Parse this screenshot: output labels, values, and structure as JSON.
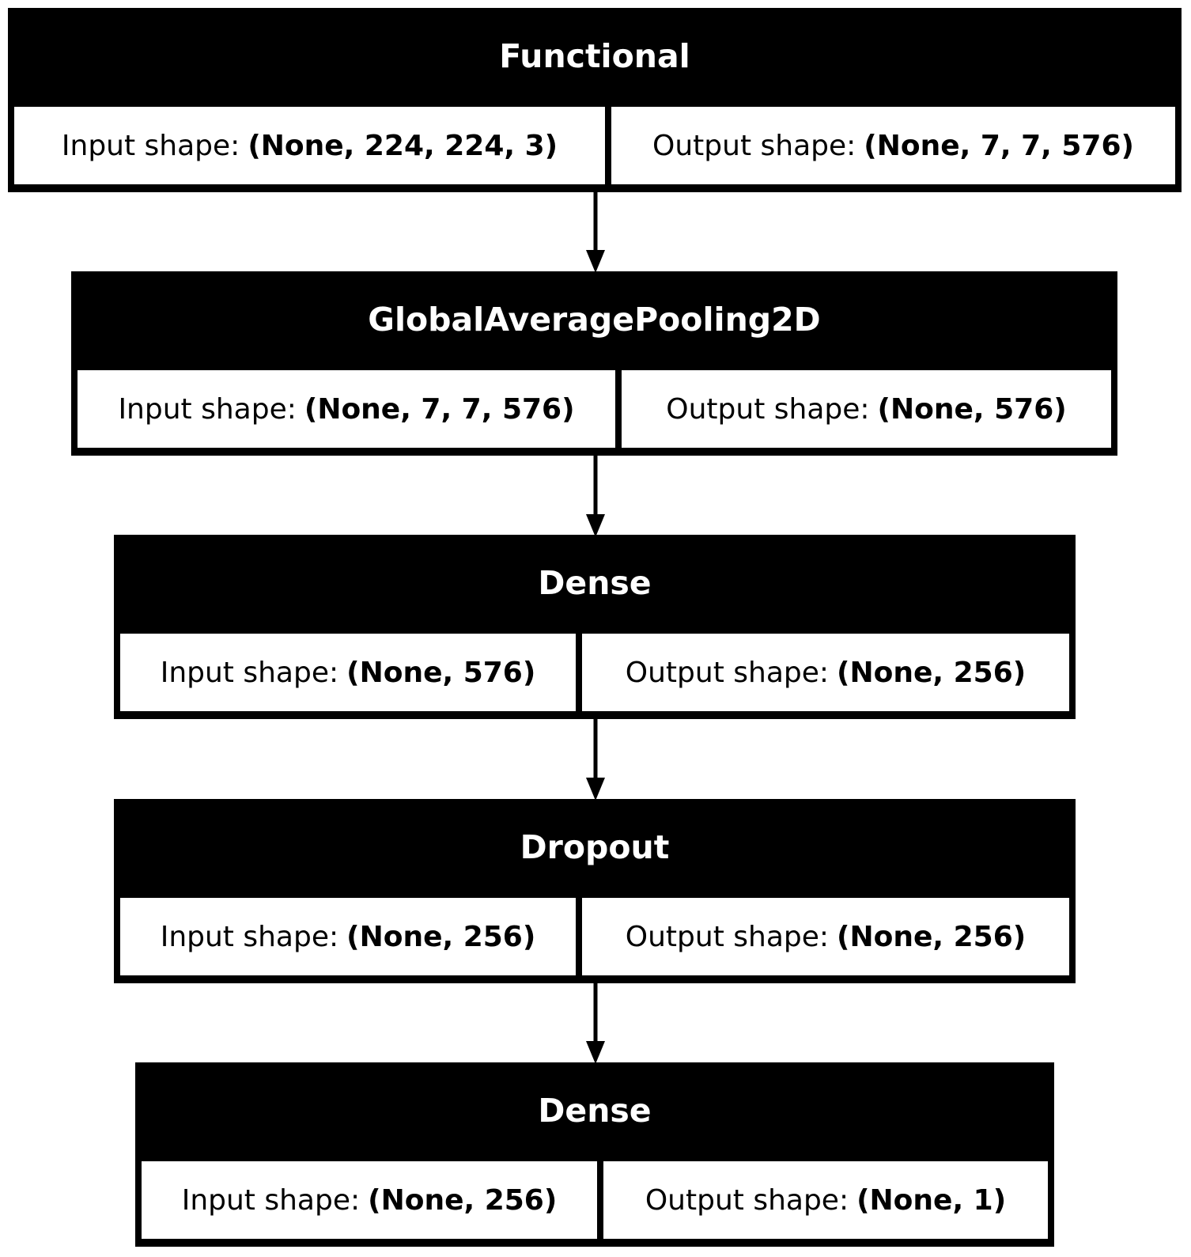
{
  "colors": {
    "layer_fill": "#000000",
    "cell_fill": "#ffffff",
    "title_text": "#ffffff",
    "edge": "#000000"
  },
  "layers": [
    {
      "name": "Functional",
      "input_label": "Input shape:",
      "input_value": "(None, 224, 224, 3)",
      "output_label": "Output shape:",
      "output_value": "(None, 7, 7, 576)"
    },
    {
      "name": "GlobalAveragePooling2D",
      "input_label": "Input shape:",
      "input_value": "(None, 7, 7, 576)",
      "output_label": "Output shape:",
      "output_value": "(None, 576)"
    },
    {
      "name": "Dense",
      "input_label": "Input shape:",
      "input_value": "(None, 576)",
      "output_label": "Output shape:",
      "output_value": "(None, 256)"
    },
    {
      "name": "Dropout",
      "input_label": "Input shape:",
      "input_value": "(None, 256)",
      "output_label": "Output shape:",
      "output_value": "(None, 256)"
    },
    {
      "name": "Dense",
      "input_label": "Input shape:",
      "input_value": "(None, 256)",
      "output_label": "Output shape:",
      "output_value": "(None, 1)"
    }
  ],
  "edges": [
    {
      "from": 0,
      "to": 1
    },
    {
      "from": 1,
      "to": 2
    },
    {
      "from": 2,
      "to": 3
    },
    {
      "from": 3,
      "to": 4
    }
  ]
}
